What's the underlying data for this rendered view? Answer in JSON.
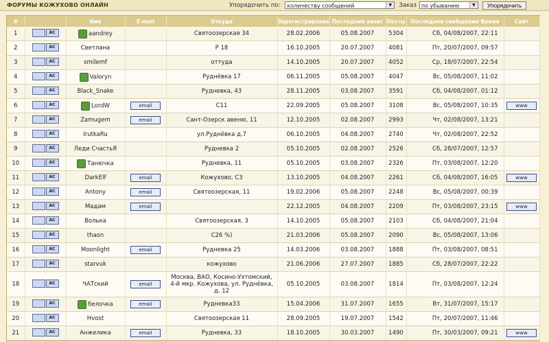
{
  "header": {
    "title": "ФОРУМЫ КОЖУХОВО ОНЛАЙН",
    "sort_label": "Упорядочить по:",
    "sort_value": "количеству сообщений",
    "order_label": "Заказ",
    "order_value": "по убыванию",
    "sort_button": "Упорядочить"
  },
  "columns": [
    "#",
    "",
    "Имя",
    "E-mail",
    "Откуда",
    "Зарегистрирован",
    "Последний визит",
    "Посты",
    "Последнее сообщение Время",
    "Сайт"
  ],
  "button_labels": {
    "pm": "АС",
    "email": "email",
    "www": "www"
  },
  "rows": [
    {
      "n": "1",
      "name": "aandrey",
      "avatar": true,
      "email": false,
      "from": "Святоозерская 34",
      "reg": "28.02.2006",
      "visit": "05.08.2007",
      "posts": "5304",
      "last": "Сб, 04/08/2007, 22:11",
      "www": false
    },
    {
      "n": "2",
      "name": "Светлана",
      "avatar": false,
      "email": false,
      "from": "Р 18",
      "reg": "16.10.2005",
      "visit": "20.07.2007",
      "posts": "4081",
      "last": "Пт, 20/07/2007, 09:57",
      "www": false
    },
    {
      "n": "3",
      "name": "smilemf",
      "avatar": false,
      "email": false,
      "from": "оттуда",
      "reg": "14.10.2005",
      "visit": "20.07.2007",
      "posts": "4052",
      "last": "Ср, 18/07/2007, 22:54",
      "www": false
    },
    {
      "n": "4",
      "name": "Valoryn",
      "avatar": true,
      "email": false,
      "from": "Руднёвка 17",
      "reg": "06.11.2005",
      "visit": "05.08.2007",
      "posts": "4047",
      "last": "Вс, 05/08/2007, 11:02",
      "www": false
    },
    {
      "n": "5",
      "name": "Black_Snake",
      "avatar": false,
      "email": false,
      "from": "Рудневка, 43",
      "reg": "28.11.2005",
      "visit": "03.08.2007",
      "posts": "3591",
      "last": "Сб, 04/08/2007, 01:12",
      "www": false
    },
    {
      "n": "6",
      "name": "LordW",
      "avatar": true,
      "email": true,
      "from": "С11",
      "reg": "22.09.2005",
      "visit": "05.08.2007",
      "posts": "3108",
      "last": "Вс, 05/08/2007, 10:35",
      "www": true
    },
    {
      "n": "7",
      "name": "Zamugem",
      "avatar": false,
      "email": true,
      "from": "Сант-Озерск авеню, 11",
      "reg": "12.10.2005",
      "visit": "02.08.2007",
      "posts": "2993",
      "last": "Чт, 02/08/2007, 13:21",
      "www": false
    },
    {
      "n": "8",
      "name": "IrutkaRu",
      "avatar": false,
      "email": false,
      "from": "ул.Руднёвка д.7",
      "reg": "06.10.2005",
      "visit": "04.08.2007",
      "posts": "2740",
      "last": "Чт, 02/08/2007, 22:52",
      "www": false
    },
    {
      "n": "9",
      "name": "Леди СчастьЯ",
      "avatar": false,
      "email": false,
      "from": "Рудневка 2",
      "reg": "05.10.2005",
      "visit": "02.08.2007",
      "posts": "2526",
      "last": "Сб, 28/07/2007, 12:57",
      "www": false
    },
    {
      "n": "10",
      "name": "Танючка",
      "avatar": true,
      "email": false,
      "from": "Рудневка, 11",
      "reg": "05.10.2005",
      "visit": "03.08.2007",
      "posts": "2326",
      "last": "Пт, 03/08/2007, 12:20",
      "www": false
    },
    {
      "n": "11",
      "name": "DarkElf",
      "avatar": false,
      "email": true,
      "from": "Кожухово, С3",
      "reg": "13.10.2005",
      "visit": "04.08.2007",
      "posts": "2261",
      "last": "Сб, 04/08/2007, 16:05",
      "www": true
    },
    {
      "n": "12",
      "name": "Antony",
      "avatar": false,
      "email": true,
      "from": "Святоозерская, 11",
      "reg": "19.02.2006",
      "visit": "05.08.2007",
      "posts": "2248",
      "last": "Вс, 05/08/2007, 00:39",
      "www": false
    },
    {
      "n": "13",
      "name": "Мадам",
      "avatar": false,
      "email": true,
      "from": "",
      "reg": "22.12.2005",
      "visit": "04.08.2007",
      "posts": "2209",
      "last": "Пт, 03/08/2007, 23:15",
      "www": true
    },
    {
      "n": "14",
      "name": "Волька",
      "avatar": false,
      "email": false,
      "from": "Святоозерская, 3",
      "reg": "14.10.2005",
      "visit": "05.08.2007",
      "posts": "2103",
      "last": "Сб, 04/08/2007, 21:04",
      "www": false
    },
    {
      "n": "15",
      "name": "thaon",
      "avatar": false,
      "email": false,
      "from": "С26 %)",
      "reg": "21.03.2006",
      "visit": "05.08.2007",
      "posts": "2090",
      "last": "Вс, 05/08/2007, 13:06",
      "www": false
    },
    {
      "n": "16",
      "name": "Moonlight",
      "avatar": false,
      "email": true,
      "from": "Рудневка 25",
      "reg": "14.03.2006",
      "visit": "03.08.2007",
      "posts": "1888",
      "last": "Пт, 03/08/2007, 08:51",
      "www": false
    },
    {
      "n": "17",
      "name": "starvuk",
      "avatar": false,
      "email": false,
      "from": "кожухово",
      "reg": "21.06.2006",
      "visit": "27.07.2007",
      "posts": "1885",
      "last": "Сб, 28/07/2007, 22:22",
      "www": false
    },
    {
      "n": "18",
      "name": "ЧАТский",
      "avatar": false,
      "email": true,
      "from": "Москва, ВАО, Косино-Ухтомский, 4-й мкр. Кожухова, ул. Руднёвка, д. 12",
      "reg": "05.10.2005",
      "visit": "03.08.2007",
      "posts": "1814",
      "last": "Пт, 03/08/2007, 12:24",
      "www": false,
      "tall": true
    },
    {
      "n": "19",
      "name": "белочка",
      "avatar": true,
      "email": true,
      "from": "Рудневка33",
      "reg": "15.04.2006",
      "visit": "31.07.2007",
      "posts": "1655",
      "last": "Вт, 31/07/2007, 15:17",
      "www": false
    },
    {
      "n": "20",
      "name": "Hvost",
      "avatar": false,
      "email": false,
      "from": "Святоозерская 11",
      "reg": "28.09.2005",
      "visit": "19.07.2007",
      "posts": "1542",
      "last": "Пт, 20/07/2007, 11:46",
      "www": false
    },
    {
      "n": "21",
      "name": "Анжелика",
      "avatar": false,
      "email": true,
      "from": "Рудневка, 33",
      "reg": "18.10.2005",
      "visit": "30.03.2007",
      "posts": "1490",
      "last": "Пт, 30/03/2007, 09:21",
      "www": true
    }
  ]
}
